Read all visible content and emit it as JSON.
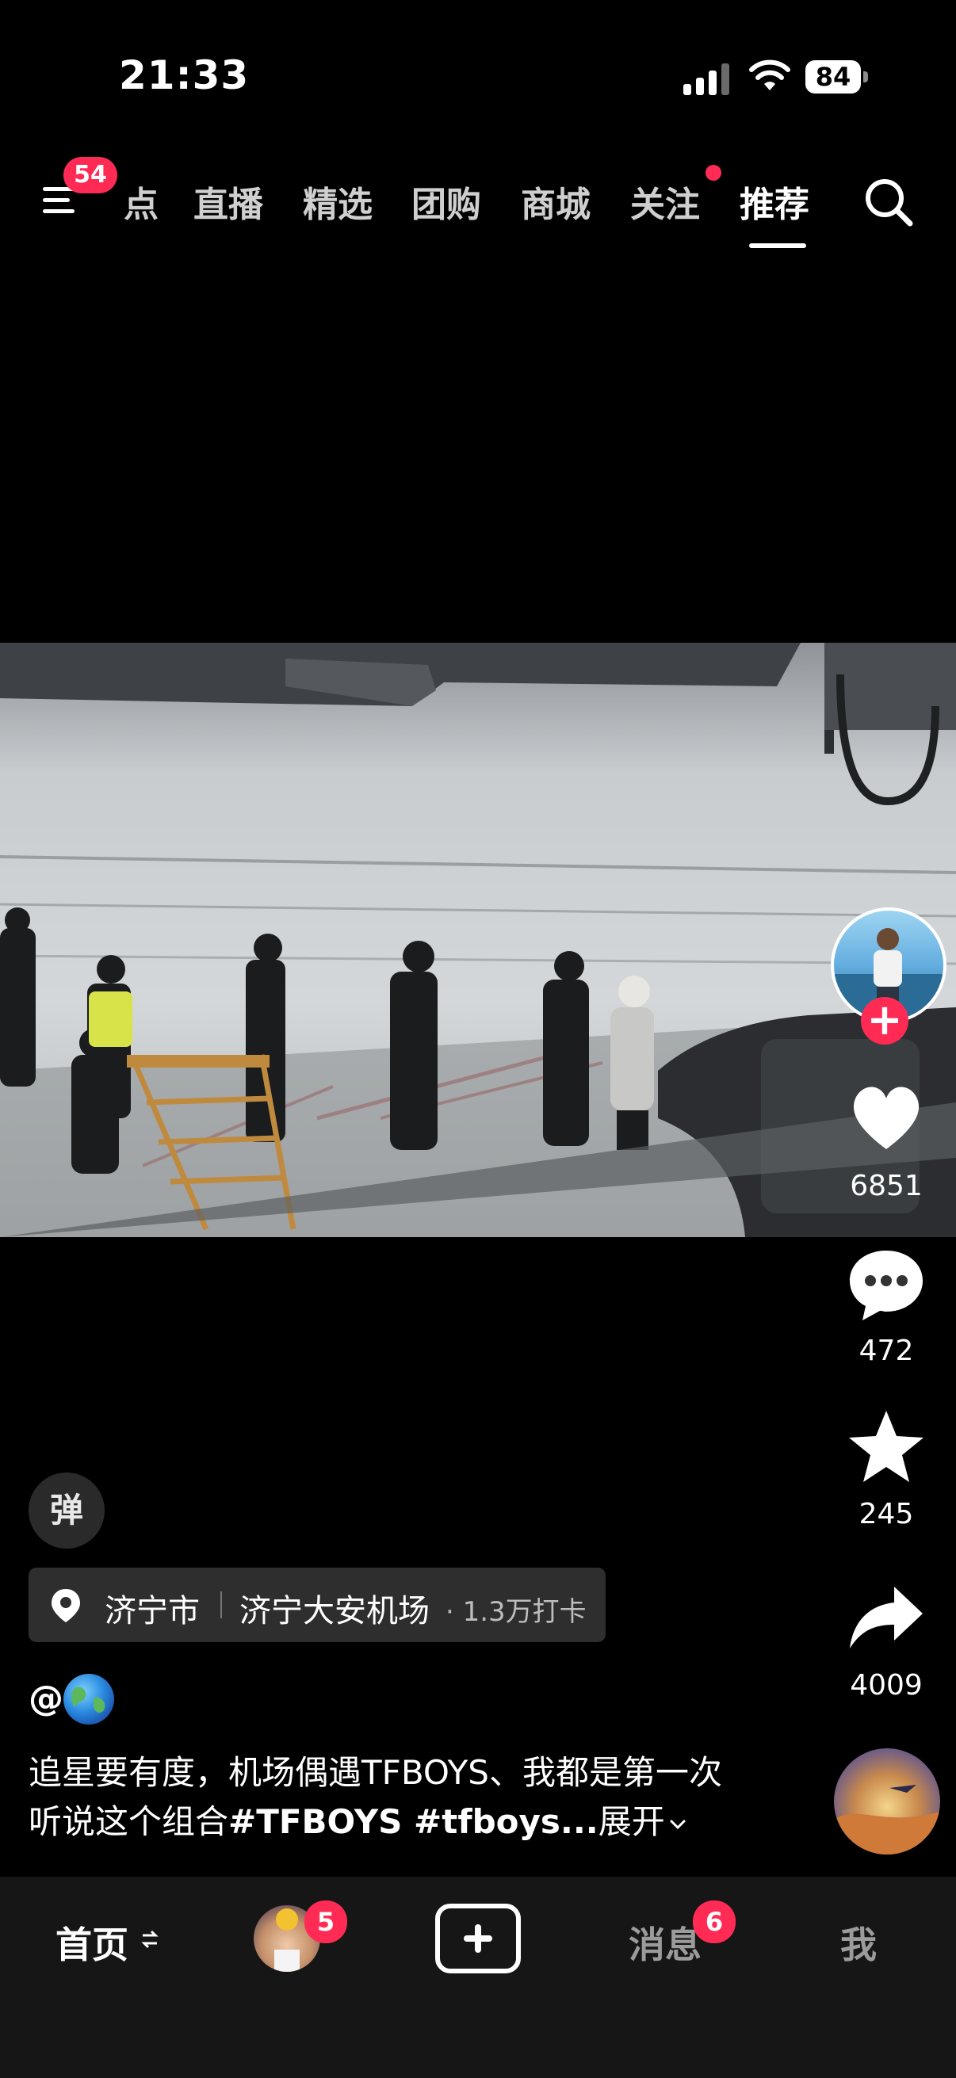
{
  "status_bar": {
    "time": "21:33",
    "battery": "84"
  },
  "top_nav": {
    "menu_badge": "54",
    "tabs": [
      {
        "label": "点",
        "active": false
      },
      {
        "label": "直播",
        "active": false
      },
      {
        "label": "精选",
        "active": false
      },
      {
        "label": "团购",
        "active": false
      },
      {
        "label": "商城",
        "active": false
      },
      {
        "label": "关注",
        "active": false,
        "dot": true
      },
      {
        "label": "推荐",
        "active": true
      }
    ]
  },
  "actions": {
    "likes": "6851",
    "comments": "472",
    "favorites": "245",
    "shares": "4009"
  },
  "danmaku_label": "弹",
  "location": {
    "city": "济宁市",
    "place": "济宁大安机场",
    "meta": "· 1.3万打卡"
  },
  "author": {
    "prefix": "@"
  },
  "caption": {
    "text": "追星要有度，机场偶遇TFBOYS、我都是第一次听说这个组合",
    "tags": "#TFBOYS #tfboys...",
    "expand": "展开"
  },
  "bottom_nav": {
    "home": "首页",
    "friends_badge": "5",
    "messages": "消息",
    "messages_badge": "6",
    "me": "我"
  },
  "colors": {
    "accent": "#ff2b55",
    "bar": "#161616"
  }
}
